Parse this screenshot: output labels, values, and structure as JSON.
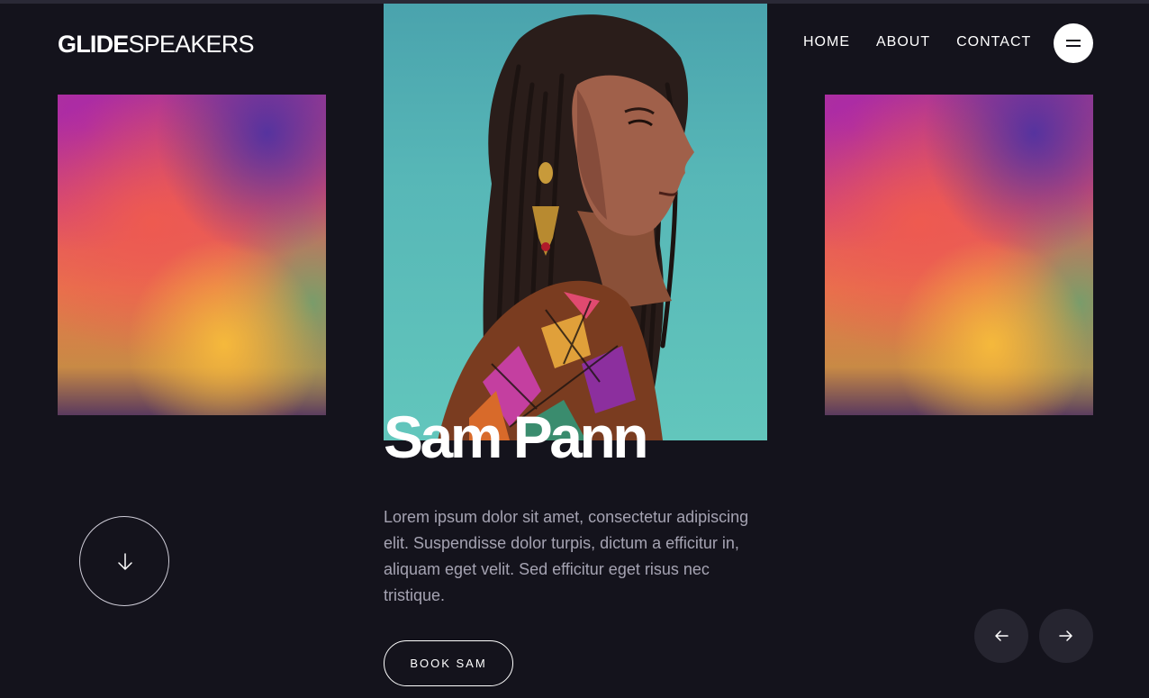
{
  "brand": {
    "logo_bold": "GLIDE",
    "logo_regular": "SPEAKERS"
  },
  "nav": {
    "items": [
      {
        "label": "HOME"
      },
      {
        "label": "ABOUT"
      },
      {
        "label": "CONTACT"
      }
    ],
    "menu_icon": "hamburger-icon"
  },
  "speaker": {
    "name": "Sam Pann",
    "description": "Lorem ipsum dolor sit amet, consectetur adipiscing elit. Suspendisse dolor turpis, dictum a efficitur in, aliquam eget velit. Sed efficitur eget risus nec tristique.",
    "cta_label": "BOOK SAM"
  },
  "controls": {
    "scroll_icon": "arrow-down-icon",
    "prev_icon": "arrow-left-icon",
    "next_icon": "arrow-right-icon"
  },
  "colors": {
    "background": "#14131c",
    "text": "#ffffff",
    "muted_text": "#a5a3b2",
    "portrait_bg": "#5bb9b6",
    "control_bg": "#262530"
  }
}
